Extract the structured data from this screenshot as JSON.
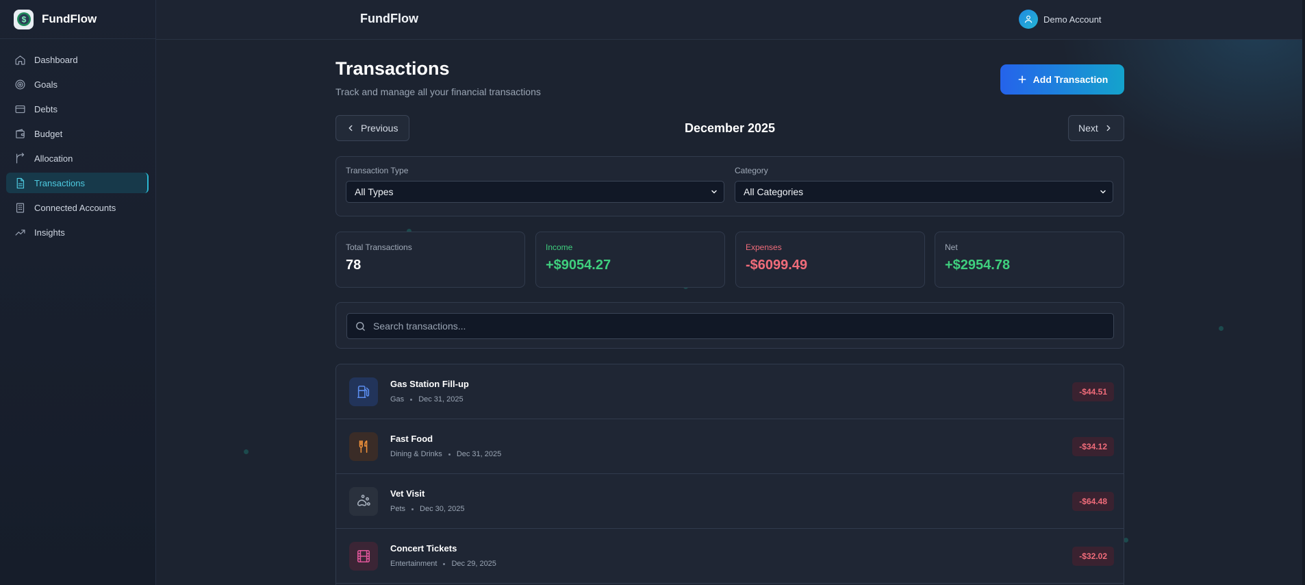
{
  "app": {
    "name": "FundFlow",
    "header_title": "FundFlow"
  },
  "account": {
    "name": "Demo Account"
  },
  "sidebar": {
    "items": [
      {
        "label": "Dashboard",
        "icon": "home-icon"
      },
      {
        "label": "Goals",
        "icon": "target-icon"
      },
      {
        "label": "Debts",
        "icon": "credit-card-icon"
      },
      {
        "label": "Budget",
        "icon": "wallet-icon"
      },
      {
        "label": "Allocation",
        "icon": "split-icon"
      },
      {
        "label": "Transactions",
        "icon": "document-icon",
        "active": true
      },
      {
        "label": "Connected Accounts",
        "icon": "bank-icon"
      },
      {
        "label": "Insights",
        "icon": "trending-up-icon"
      }
    ]
  },
  "page": {
    "title": "Transactions",
    "subtitle": "Track and manage all your financial transactions",
    "add_button": "Add Transaction"
  },
  "month_nav": {
    "previous": "Previous",
    "current": "December 2025",
    "next": "Next"
  },
  "filters": {
    "type": {
      "label": "Transaction Type",
      "value": "All Types"
    },
    "category": {
      "label": "Category",
      "value": "All Categories"
    }
  },
  "stats": {
    "total": {
      "label": "Total Transactions",
      "value": "78"
    },
    "income": {
      "label": "Income",
      "value": "+$9054.27"
    },
    "expenses": {
      "label": "Expenses",
      "value": "-$6099.49"
    },
    "net": {
      "label": "Net",
      "value": "+$2954.78"
    }
  },
  "search": {
    "placeholder": "Search transactions..."
  },
  "transactions": [
    {
      "name": "Gas Station Fill-up",
      "category": "Gas",
      "date": "Dec 31, 2025",
      "amount": "-$44.51",
      "icon": "fuel-icon",
      "color": "#5b8def"
    },
    {
      "name": "Fast Food",
      "category": "Dining & Drinks",
      "date": "Dec 31, 2025",
      "amount": "-$34.12",
      "icon": "utensils-icon",
      "color": "#f0913a"
    },
    {
      "name": "Vet Visit",
      "category": "Pets",
      "date": "Dec 30, 2025",
      "amount": "-$64.48",
      "icon": "paw-icon",
      "color": "#a7b0bd"
    },
    {
      "name": "Concert Tickets",
      "category": "Entertainment",
      "date": "Dec 29, 2025",
      "amount": "-$32.02",
      "icon": "film-icon",
      "color": "#e0569a"
    }
  ],
  "colors": {
    "accent": "#2bb8d2",
    "income": "#3fcf7e",
    "expense": "#f06c7a",
    "button_start": "#2563eb",
    "button_end": "#14a3cc"
  }
}
